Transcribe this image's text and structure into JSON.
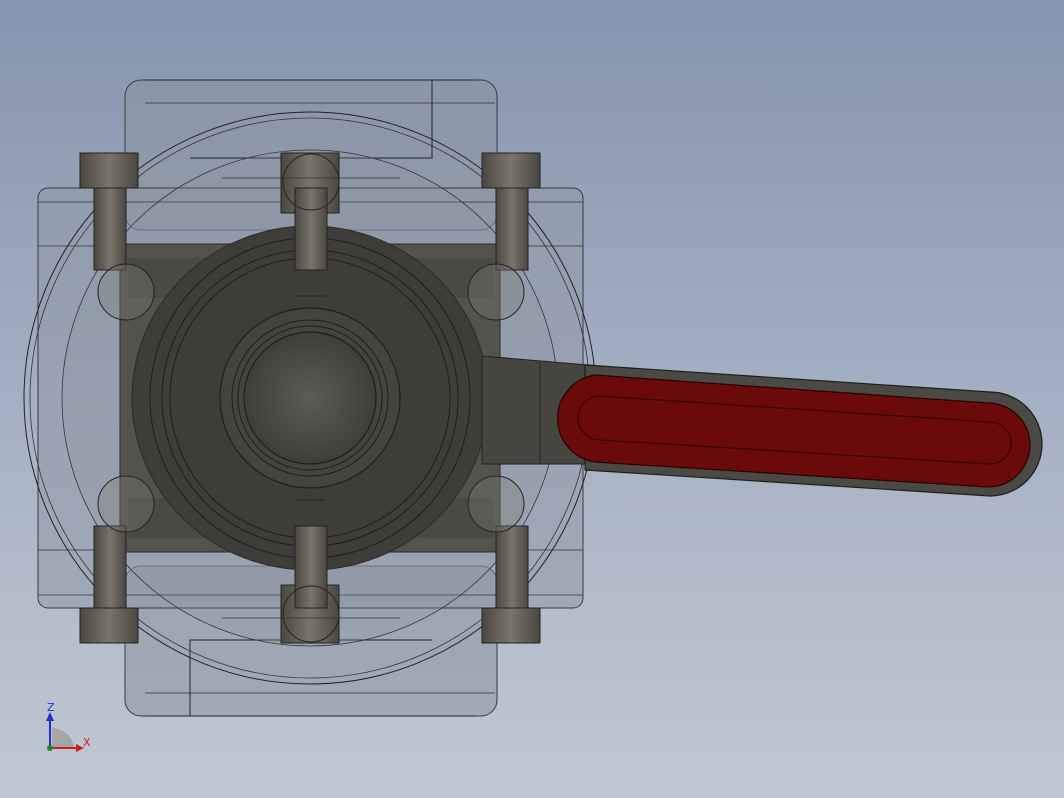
{
  "viewport": {
    "background_top": "#8595ad",
    "background_bottom": "#c1c8d3"
  },
  "model": {
    "body_color": "#3d3c38",
    "bolt_color": "#5e5a52",
    "shell_color": "#8d96a4",
    "handle_color": "#6b0a0a",
    "handle_outline": "#2a2a2a"
  },
  "triad": {
    "z_label": "Z",
    "x_label": "X",
    "z_color": "#1e2fd0",
    "x_color": "#d01e1e"
  }
}
